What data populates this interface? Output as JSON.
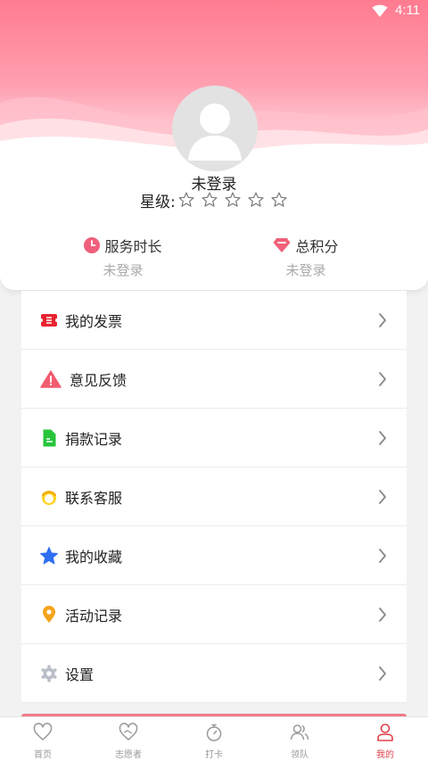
{
  "status_bar": {
    "time": "4:11"
  },
  "profile": {
    "name": "未登录",
    "star_label": "星级:",
    "stars": {
      "rating": 0,
      "max": 5
    }
  },
  "stats": {
    "service_hours": {
      "label": "服务时长",
      "value": "未登录"
    },
    "total_points": {
      "label": "总积分",
      "value": "未登录"
    }
  },
  "menu": [
    {
      "label": "我的发票",
      "icon": "invoice-icon"
    },
    {
      "label": "意见反馈",
      "icon": "warning-icon"
    },
    {
      "label": "捐款记录",
      "icon": "document-icon"
    },
    {
      "label": "联系客服",
      "icon": "customer-service-icon"
    },
    {
      "label": "我的收藏",
      "icon": "star-icon"
    },
    {
      "label": "活动记录",
      "icon": "location-pin-icon"
    },
    {
      "label": "设置",
      "icon": "gear-icon"
    }
  ],
  "tabs": [
    {
      "label": "首页",
      "icon": "heart-icon",
      "active": false
    },
    {
      "label": "志愿者",
      "icon": "volunteer-heart-icon",
      "active": false
    },
    {
      "label": "打卡",
      "icon": "stopwatch-icon",
      "active": false
    },
    {
      "label": "领队",
      "icon": "team-icon",
      "active": false
    },
    {
      "label": "我的",
      "icon": "person-icon",
      "active": true
    }
  ],
  "colors": {
    "header_gradient_top": "#ff7d92",
    "header_gradient_bottom": "#ffd5dc",
    "active_tab": "#e0414d",
    "inactive_tab": "#999999"
  }
}
